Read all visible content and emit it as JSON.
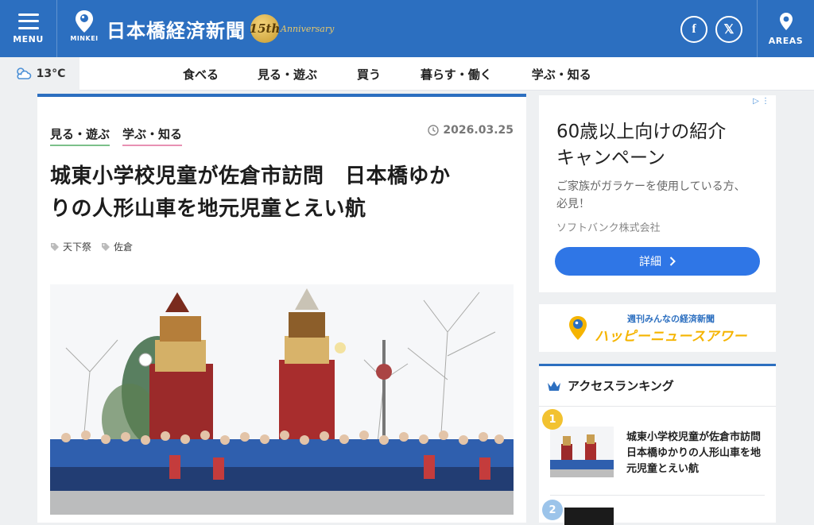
{
  "header": {
    "menu_label": "MENU",
    "logo_sub": "MINKEI",
    "site_name": "日本橋経済新聞",
    "anniversary_number": "15th",
    "anniversary_word": "Anniversary",
    "facebook_glyph": "f",
    "x_glyph": "𝕏",
    "areas_label": "AREAS"
  },
  "weather": {
    "temperature": "13°C",
    "icon": "cloudy-icon"
  },
  "nav": {
    "items": [
      {
        "label": "食べる"
      },
      {
        "label": "見る・遊ぶ"
      },
      {
        "label": "買う"
      },
      {
        "label": "暮らす・働く"
      },
      {
        "label": "学ぶ・知る"
      }
    ]
  },
  "article": {
    "categories": [
      {
        "label": "見る・遊ぶ"
      },
      {
        "label": "学ぶ・知る"
      }
    ],
    "date": "2026.03.25",
    "title_line1": "城東小学校児童が佐倉市訪問　日本橋ゆか",
    "title_line2": "りの人形山車を地元児童とえい航",
    "tags": [
      {
        "label": "天下祭"
      },
      {
        "label": "佐倉"
      }
    ]
  },
  "ad": {
    "title_line1": "60歳以上向けの紹介",
    "title_line2": "キャンペーン",
    "desc_line1": "ご家族がガラケーを使用している方、",
    "desc_line2": "必見！",
    "company": "ソフトバンク株式会社",
    "button_label": "詳細"
  },
  "happy_news": {
    "small": "週刊みんなの経済新聞",
    "large": "ハッピーニュースアワー"
  },
  "ranking": {
    "heading": "アクセスランキング",
    "items": [
      {
        "rank": "1",
        "title": "城東小学校児童が佐倉市訪問　日本橋ゆかりの人形山車を地元児童とえい航"
      },
      {
        "rank": "2"
      }
    ]
  },
  "colors": {
    "brand_blue": "#2c6fc0",
    "cta_blue": "#2f76e6",
    "rank_gold": "#f2c230",
    "happy_yellow": "#f5b400"
  }
}
